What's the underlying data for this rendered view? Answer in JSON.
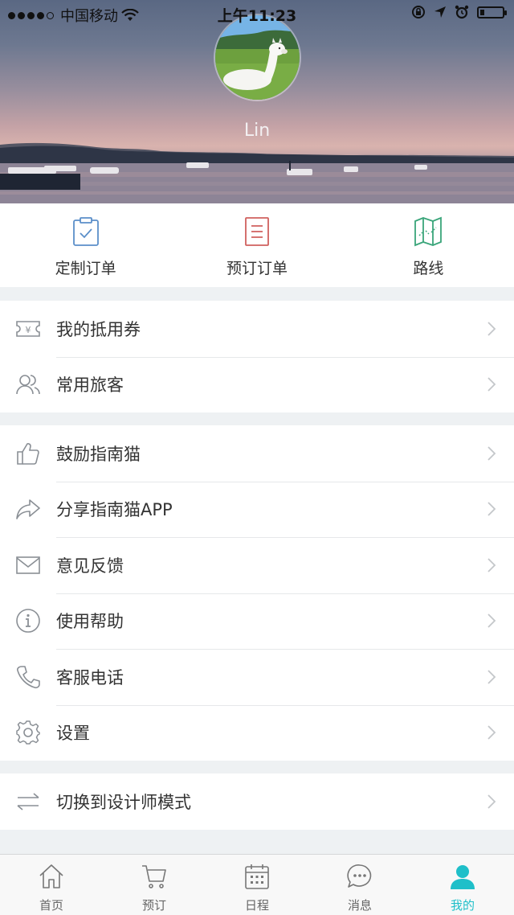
{
  "status_bar": {
    "carrier": "中国移动",
    "time": "上午11:23",
    "battery_level": 0.2
  },
  "profile": {
    "username": "Lin"
  },
  "quick_actions": [
    {
      "label": "定制订单",
      "icon": "clipboard-check-icon",
      "color": "#5b8fc9"
    },
    {
      "label": "预订订单",
      "icon": "document-list-icon",
      "color": "#d0605e"
    },
    {
      "label": "路线",
      "icon": "map-icon",
      "color": "#3aa57a"
    }
  ],
  "groups": [
    {
      "items": [
        {
          "label": "我的抵用券",
          "icon": "voucher-icon"
        },
        {
          "label": "常用旅客",
          "icon": "travelers-icon"
        }
      ]
    },
    {
      "items": [
        {
          "label": "鼓励指南猫",
          "icon": "thumbs-up-icon"
        },
        {
          "label": "分享指南猫APP",
          "icon": "share-icon"
        },
        {
          "label": "意见反馈",
          "icon": "mail-icon"
        },
        {
          "label": "使用帮助",
          "icon": "info-icon"
        },
        {
          "label": "客服电话",
          "icon": "phone-icon"
        },
        {
          "label": "设置",
          "icon": "gear-icon"
        }
      ]
    },
    {
      "items": [
        {
          "label": "切换到设计师模式",
          "icon": "switch-icon"
        }
      ]
    }
  ],
  "tabbar": {
    "items": [
      {
        "label": "首页",
        "icon": "home-icon"
      },
      {
        "label": "预订",
        "icon": "cart-icon"
      },
      {
        "label": "日程",
        "icon": "calendar-icon"
      },
      {
        "label": "消息",
        "icon": "message-icon"
      },
      {
        "label": "我的",
        "icon": "user-icon"
      }
    ],
    "active_index": 4,
    "active_color": "#1fbfc9",
    "inactive_color": "#777777"
  }
}
